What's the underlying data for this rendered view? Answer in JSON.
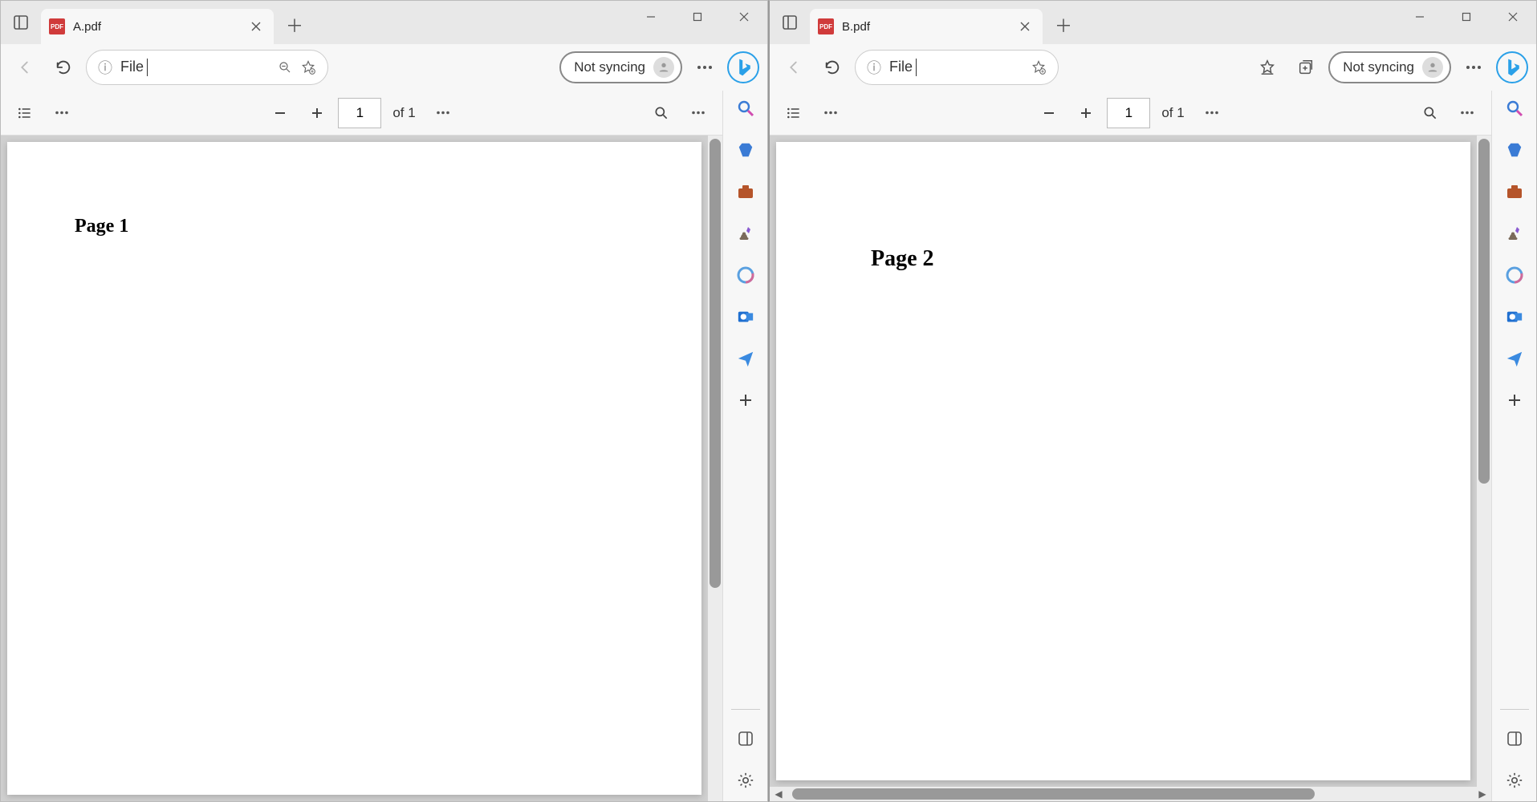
{
  "windows": [
    {
      "tab": {
        "title": "A.pdf",
        "icon_label": "PDF"
      },
      "address": {
        "text": "File"
      },
      "sync": {
        "label": "Not syncing"
      },
      "pdf": {
        "page_input": "1",
        "page_of": "of 1",
        "content": "Page 1"
      },
      "has_favorites_btn": false,
      "has_collections_btn": false,
      "has_hscroll": false
    },
    {
      "tab": {
        "title": "B.pdf",
        "icon_label": "PDF"
      },
      "address": {
        "text": "File"
      },
      "sync": {
        "label": "Not syncing"
      },
      "pdf": {
        "page_input": "1",
        "page_of": "of 1",
        "content": "Page 2"
      },
      "has_favorites_btn": true,
      "has_collections_btn": true,
      "has_hscroll": true
    }
  ]
}
